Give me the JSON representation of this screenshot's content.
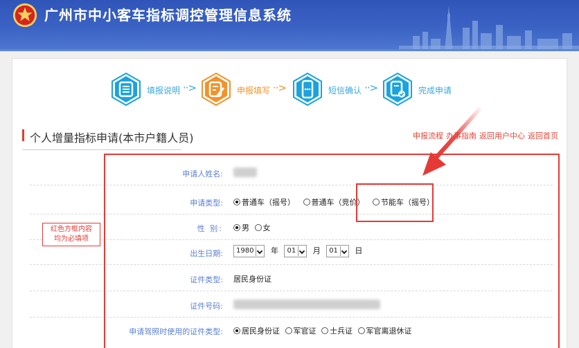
{
  "header": {
    "site_title": "广州市中小客车指标调控管理信息系统"
  },
  "steps": [
    {
      "label": "填报说明",
      "color": "#1aa3de"
    },
    {
      "label": "申报填写",
      "color": "#f0932b"
    },
    {
      "label": "短信确认",
      "color": "#1aa3de"
    },
    {
      "label": "完成申请",
      "color": "#1aa3de"
    }
  ],
  "arrows": "··>",
  "section": {
    "title": "个人增量指标申请(本市户籍人员)"
  },
  "top_links": [
    "申报流程",
    "办事指南",
    "返回用户中心",
    "返回首页"
  ],
  "form": {
    "name_label": "申请人姓名:",
    "type_label": "申请类型:",
    "type_options": [
      "普通车（摇号）",
      "普通车（竞价）",
      "节能车（摇号）"
    ],
    "type_selected": 0,
    "gender_label": "性    别:",
    "gender_options": [
      "男",
      "女"
    ],
    "gender_selected": 0,
    "birth_label": "出生日期:",
    "birth_year": "1980",
    "birth_year_unit": "年",
    "birth_month": "01",
    "birth_month_unit": "月",
    "birth_day": "01",
    "birth_day_unit": "日",
    "id_type_label": "证件类型:",
    "id_type_value": "居民身份证",
    "id_number_label": "证件号码:",
    "license_id_label": "申请驾照时使用的证件类型:",
    "license_id_options": [
      "居民身份证",
      "军官证",
      "士兵证",
      "军官离退休证"
    ],
    "license_id_selected": 0
  },
  "annotation": {
    "note_line1": "红色方框内容",
    "note_line2": "均为必填项"
  },
  "colors": {
    "header_blue": "#3b63c4",
    "accent_red": "#e53935",
    "label_blue": "#5b7fd0"
  }
}
